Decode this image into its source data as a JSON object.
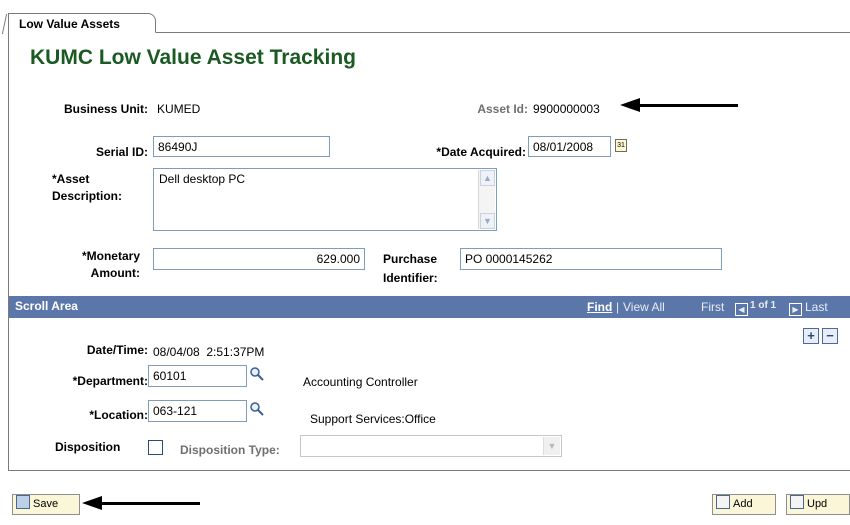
{
  "tab": {
    "label": "Low Value Assets"
  },
  "page_title": "KUMC Low Value Asset Tracking",
  "form": {
    "business_unit_label": "Business Unit:",
    "business_unit_value": "KUMED",
    "asset_id_label": "Asset Id:",
    "asset_id_value": "9900000003",
    "serial_id_label": "Serial ID:",
    "serial_id_value": "86490J",
    "date_acquired_label": "*Date Acquired:",
    "date_acquired_value": "08/01/2008",
    "asset_desc_label_1": "*Asset",
    "asset_desc_label_2": "Description:",
    "asset_desc_value": "Dell desktop PC",
    "monetary_label_1": "*Monetary",
    "monetary_label_2": "Amount:",
    "monetary_value": "629.000",
    "purchase_label_1": "Purchase",
    "purchase_label_2": "Identifier:",
    "purchase_value": "PO 0000145262"
  },
  "scroll_area": {
    "title": "Scroll Area",
    "find": "Find",
    "separator": "|",
    "view_all": "View All",
    "first": "First",
    "count": "1 of 1",
    "last": "Last",
    "datetime_label": "Date/Time:",
    "datetime_value": "08/04/08  2:51:37PM",
    "department_label": "*Department:",
    "department_value": "60101",
    "department_desc": "Accounting Controller",
    "location_label": "*Location:",
    "location_value": "063-121",
    "location_desc": "Support Services:Office",
    "disposition_label": "Disposition",
    "disposition_type_label": "Disposition Type:",
    "disposition_type_value": ""
  },
  "toolbar": {
    "save_label": "Save",
    "add_label": "Add",
    "update_label": "Upd"
  },
  "icons": {
    "calendar": "calendar-icon",
    "lookup": "magnifier-icon",
    "save": "floppy-icon"
  }
}
